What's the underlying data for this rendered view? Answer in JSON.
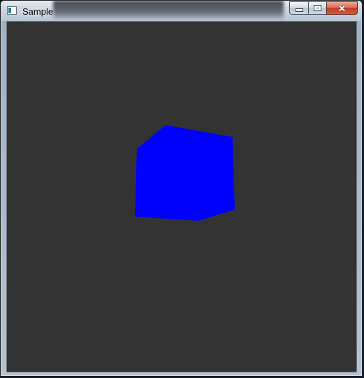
{
  "window": {
    "title": "Sample",
    "app_icon": "window-app-icon",
    "controls": {
      "minimize_icon": "minimize-icon",
      "maximize_icon": "maximize-icon",
      "close_glyph": "✕"
    }
  },
  "canvas": {
    "background_color": "#333333",
    "object": {
      "shape": "cube",
      "color": "#0000ff"
    }
  }
}
